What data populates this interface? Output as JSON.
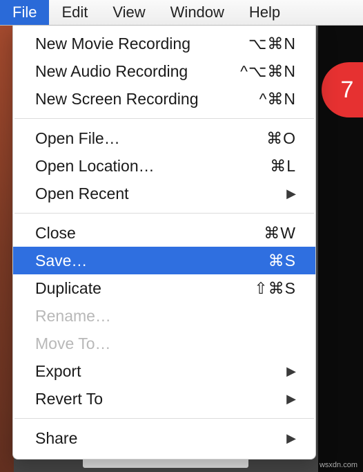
{
  "menubar": {
    "items": [
      {
        "label": "File",
        "active": true
      },
      {
        "label": "Edit",
        "active": false
      },
      {
        "label": "View",
        "active": false
      },
      {
        "label": "Window",
        "active": false
      },
      {
        "label": "Help",
        "active": false
      }
    ]
  },
  "badge": {
    "text": "7"
  },
  "menu": {
    "groups": [
      [
        {
          "label": "New Movie Recording",
          "shortcut": "⌥⌘N",
          "disabled": false,
          "selected": false,
          "submenu": false
        },
        {
          "label": "New Audio Recording",
          "shortcut": "^⌥⌘N",
          "disabled": false,
          "selected": false,
          "submenu": false
        },
        {
          "label": "New Screen Recording",
          "shortcut": "^⌘N",
          "disabled": false,
          "selected": false,
          "submenu": false
        }
      ],
      [
        {
          "label": "Open File…",
          "shortcut": "⌘O",
          "disabled": false,
          "selected": false,
          "submenu": false
        },
        {
          "label": "Open Location…",
          "shortcut": "⌘L",
          "disabled": false,
          "selected": false,
          "submenu": false
        },
        {
          "label": "Open Recent",
          "shortcut": "",
          "disabled": false,
          "selected": false,
          "submenu": true
        }
      ],
      [
        {
          "label": "Close",
          "shortcut": "⌘W",
          "disabled": false,
          "selected": false,
          "submenu": false
        },
        {
          "label": "Save…",
          "shortcut": "⌘S",
          "disabled": false,
          "selected": true,
          "submenu": false
        },
        {
          "label": "Duplicate",
          "shortcut": "⇧⌘S",
          "disabled": false,
          "selected": false,
          "submenu": false
        },
        {
          "label": "Rename…",
          "shortcut": "",
          "disabled": true,
          "selected": false,
          "submenu": false
        },
        {
          "label": "Move To…",
          "shortcut": "",
          "disabled": true,
          "selected": false,
          "submenu": false
        },
        {
          "label": "Export",
          "shortcut": "",
          "disabled": false,
          "selected": false,
          "submenu": true
        },
        {
          "label": "Revert To",
          "shortcut": "",
          "disabled": false,
          "selected": false,
          "submenu": true
        }
      ],
      [
        {
          "label": "Share",
          "shortcut": "",
          "disabled": false,
          "selected": false,
          "submenu": true
        }
      ]
    ]
  },
  "watermark": "wsxdn.com"
}
